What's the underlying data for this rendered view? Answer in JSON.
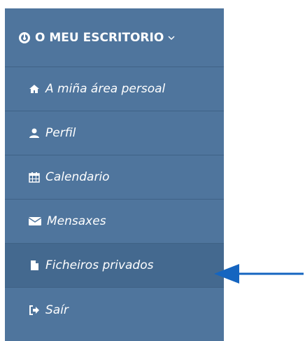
{
  "menu": {
    "header": {
      "label": "O MEU ESCRITORIO",
      "icon": "dashboard-icon",
      "chevron_icon": "chevron-down-icon"
    },
    "items": [
      {
        "label": "A miña área persoal",
        "icon": "home-icon"
      },
      {
        "label": "Perfil",
        "icon": "user-icon"
      },
      {
        "label": "Calendario",
        "icon": "calendar-icon"
      },
      {
        "label": "Mensaxes",
        "icon": "envelope-icon"
      },
      {
        "label": "Ficheiros privados",
        "icon": "file-icon",
        "active": true
      },
      {
        "label": "Saír",
        "icon": "sign-out-icon"
      }
    ]
  },
  "annotation": {
    "arrow_icon": "arrow-left-icon",
    "color": "#1565c0"
  },
  "colors": {
    "menu_bg": "#4f759d",
    "active_bg": "#44698f",
    "text": "#ffffff"
  }
}
